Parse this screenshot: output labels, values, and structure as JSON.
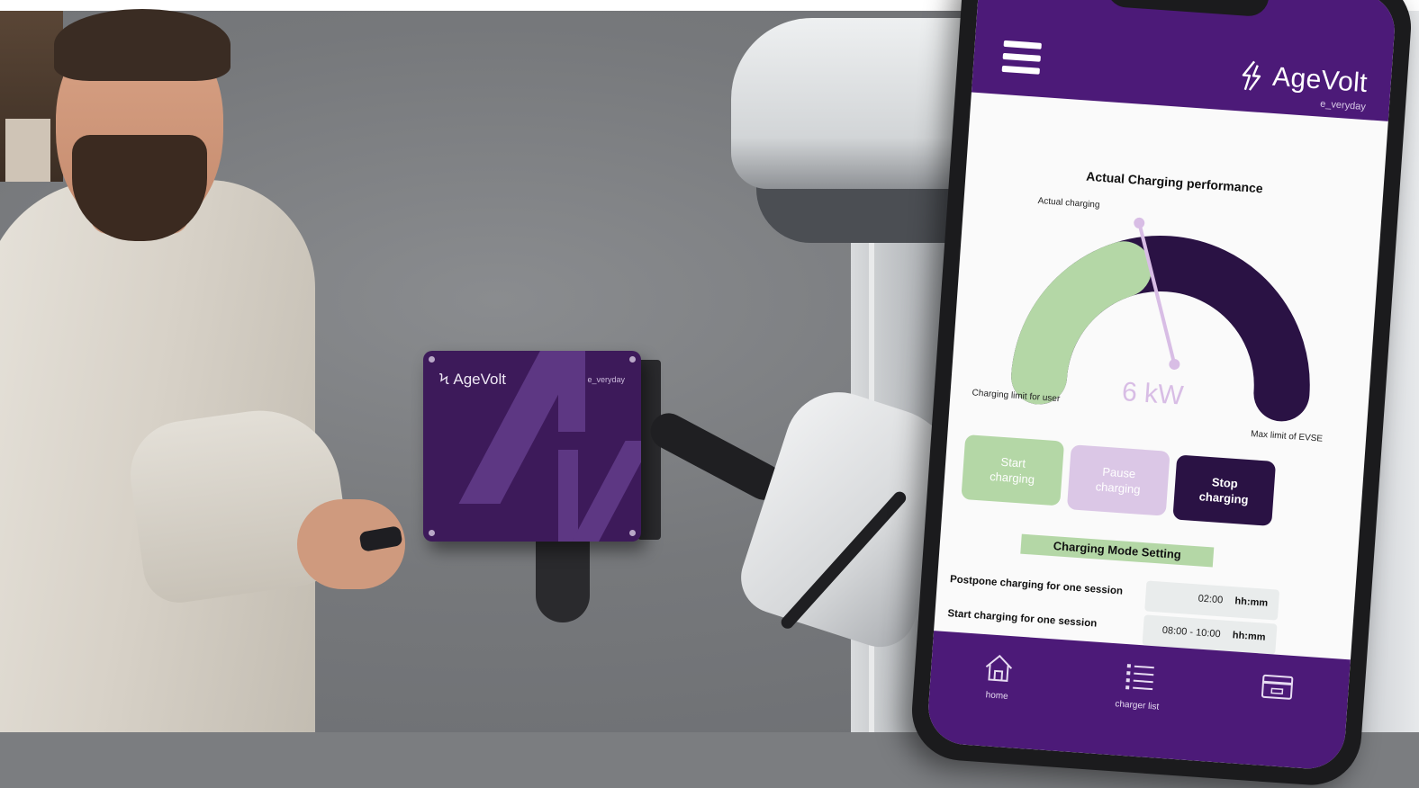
{
  "charger": {
    "logo_text": "AgeVolt",
    "tagline": "e_veryday"
  },
  "app": {
    "brand_name": "AgeVolt",
    "brand_tagline": "e_veryday",
    "menu_icon": "hamburger-menu-icon",
    "brand_icon": "bolt-icon",
    "accent_color": "#4c1a78",
    "green_color": "#b4d7a6",
    "lilac_color": "#dbc7e6",
    "dark_color": "#2a1244"
  },
  "performance": {
    "title": "Actual Charging performance",
    "actual_label": "Actual charging",
    "user_limit_label": "Charging limit for user",
    "max_limit_label": "Max limit of EVSE",
    "value": "6 kW",
    "fill_fraction": 0.38
  },
  "buttons": {
    "start": "Start\ncharging",
    "pause": "Pause\ncharging",
    "stop": "Stop\ncharging"
  },
  "mode": {
    "heading": "Charging Mode Setting",
    "postpone_label": "Postpone charging for one session",
    "postpone_value": "02:00",
    "postpone_unit": "hh:mm",
    "start_label": "Start charging for one session",
    "start_value": "08:00 - 10:00",
    "start_unit": "hh:mm"
  },
  "nav": {
    "home": "home",
    "home_icon": "home-icon",
    "charger_list": "charger list",
    "charger_list_icon": "list-icon",
    "credit_icon": "card-icon"
  }
}
